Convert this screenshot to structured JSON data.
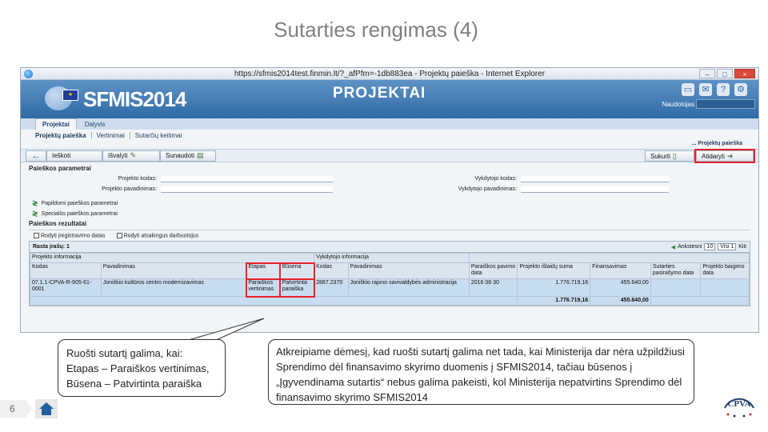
{
  "slide": {
    "title": "Sutarties rengimas (4)",
    "page_number": "6"
  },
  "browser": {
    "title": "https://sfmis2014test.finmin.lt/?_afPfm=-1db883ea - Projektų paieška - Internet Explorer",
    "close_label": "×"
  },
  "app": {
    "brand": "SFMIS2014",
    "module": "PROJEKTAI",
    "user_label": "Naudotojas"
  },
  "tabs_main": [
    "Projektai",
    "Dalyvis"
  ],
  "tabs_sub": [
    "Projektų paieška",
    "Vertinimai",
    "Sutarčių keitimai"
  ],
  "breadcrumb": "... Projektų paieška",
  "toolbar": {
    "back": "←",
    "search": "Ieškoti",
    "clear": "Išvalyti",
    "compare": "Sunaudoti",
    "create": "Sukurti",
    "open": "Atidaryti"
  },
  "search_params": {
    "title": "Paieškos parametrai",
    "project_code_label": "Projekto kodas:",
    "project_name_label": "Projekto pavadinimas:",
    "executor_code_label": "Vykdytojo kodas:",
    "executor_name_label": "Vykdytojo pavadinimas:",
    "extra_params": "Papildomi paieškos parametrai",
    "special_params": "Specialūs paieškos parametrai"
  },
  "results": {
    "title": "Paieškos rezultatai",
    "check_reg_dates": "Rodyti įregistravimo datas",
    "check_responsible": "Rodyti atsakingus darbuotojus",
    "found_label": "Rasta įrašų: 1",
    "pager_show": "Ankstesni",
    "pager_size": "10",
    "pager_page": "Visi 1",
    "pager_next": "Kiti"
  },
  "grid": {
    "group_headers": [
      "Projekto informacija",
      "Vykdytojo informacija"
    ],
    "columns": [
      "Kodas",
      "Pavadinimas",
      "Etapas",
      "Būsena",
      "Kodas",
      "Pavadinimas",
      "Paraiškos pavimo data",
      "Projekto išlaidų suma",
      "Finansavimas",
      "Sutarties pasirašymo data",
      "Projekto baigimo data"
    ],
    "row": {
      "code": "07.1.1-CPVA-R-905-61-0001",
      "name": "Joniškio kultūros centro modernizavimas",
      "stage": "Paraiškos vertinimas",
      "status": "Patvirtinta paraiška",
      "exec_code": "2887.2370",
      "exec_name": "Joniškio rajono savivaldybės administracija",
      "submit_date": "2016 08 30",
      "sum": "1.776.719,16",
      "financing": "455.640,00"
    },
    "totals": {
      "sum": "1.776.719,16",
      "financing": "455.640,00"
    }
  },
  "callouts": {
    "left": [
      "Ruošti sutartį galima, kai:",
      "Etapas – Paraiškos vertinimas,",
      "Būsena – Patvirtinta paraiška"
    ],
    "right": "Atkreipiame dėmesį, kad ruošti sutartį galima net tada, kai Ministerija dar nėra užpildžiusi Sprendimo dėl finansavimo skyrimo duomenis į SFMIS2014, tačiau būsenos į „Įgyvendinama sutartis“ nebus galima pakeisti, kol Ministerija nepatvirtins Sprendimo dėl finansavimo skyrimo SFMIS2014"
  },
  "logo": {
    "text": "CPVA"
  },
  "colors": {
    "banner": "#2f6aa5",
    "highlight": "#e3232b",
    "selected_row": "#c8dcf0"
  }
}
